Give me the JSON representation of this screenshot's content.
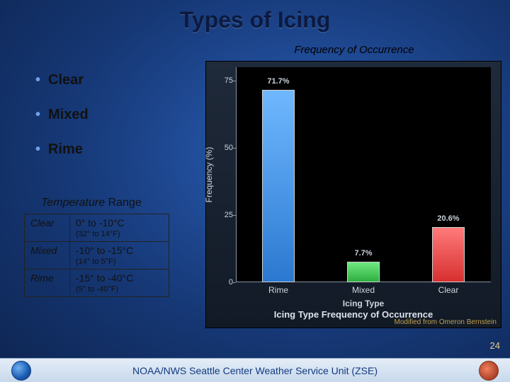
{
  "title": "Types of Icing",
  "freq_subtitle": "Frequency of Occurrence",
  "bullets": [
    "Clear",
    "Mixed",
    "Rime"
  ],
  "temp_range_label_italic": "Temperature",
  "temp_range_label_rest": " Range",
  "temp_rows": [
    {
      "name": "Clear",
      "c": "0° to -10°C",
      "f": "(32° to 14°F)"
    },
    {
      "name": "Mixed",
      "c": "-10° to -15°C",
      "f": "(14° to 5°F)"
    },
    {
      "name": "Rime",
      "c": "-15° to -40°C",
      "f": "(5° to -40°F)"
    }
  ],
  "chart_data": {
    "type": "bar",
    "categories": [
      "Rime",
      "Mixed",
      "Clear"
    ],
    "values": [
      71.7,
      7.7,
      20.6
    ],
    "value_labels": [
      "71.7%",
      "7.7%",
      "20.6%"
    ],
    "colors": [
      "#4fa0f0",
      "#3fd050",
      "#f04040"
    ],
    "yticks": [
      0,
      25,
      50,
      75
    ],
    "ylim": [
      0,
      80
    ],
    "ylabel": "Frequency (%)",
    "xlabel": "Icing Type",
    "title": "Icing Type Frequency of Occurrence",
    "attribution": "Modified from Omeron Bernstein"
  },
  "slide_number": "24",
  "footer": "NOAA/NWS Seattle Center Weather Service Unit (ZSE)"
}
